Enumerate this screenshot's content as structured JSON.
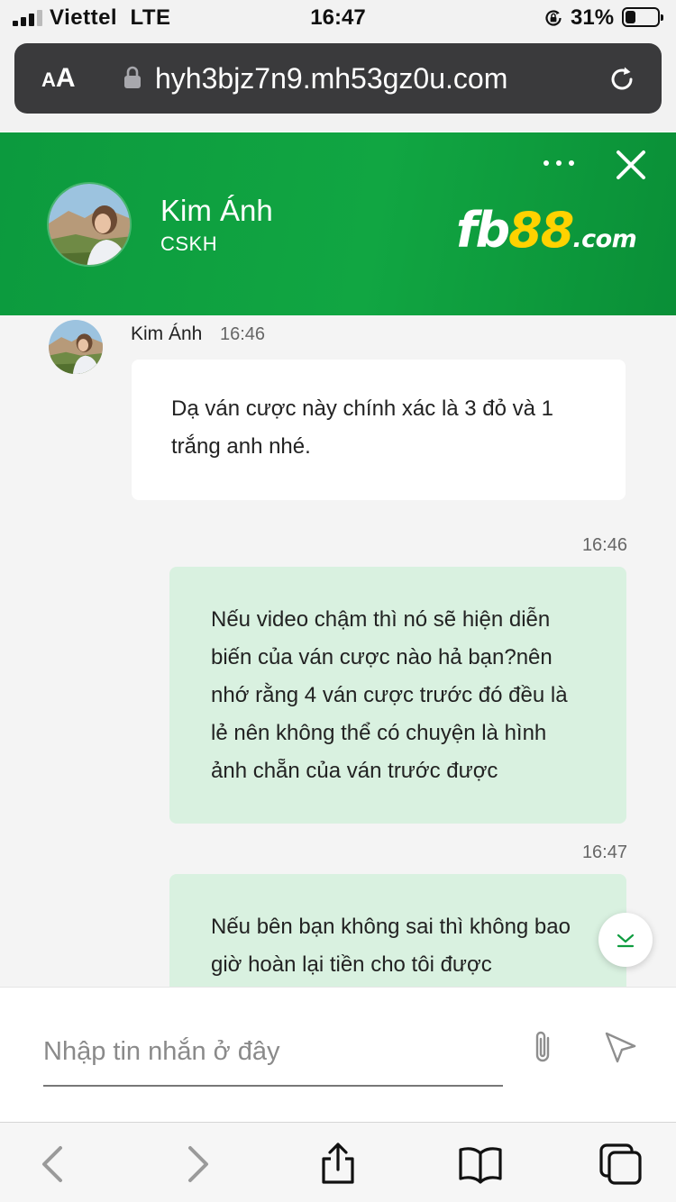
{
  "status_bar": {
    "carrier": "Viettel",
    "network": "LTE",
    "time": "16:47",
    "battery_percent": "31%",
    "battery_level": 0.31
  },
  "browser": {
    "text_size_small": "A",
    "text_size_large": "A",
    "url": "hyh3bjz7n9.mh53gz0u.com"
  },
  "chat_header": {
    "agent_name": "Kim Ánh",
    "agent_role": "CSKH",
    "brand_part1": "fb",
    "brand_part2": "88",
    "brand_part3": ".com",
    "colors": {
      "header_green": "#11a642",
      "brand_yellow": "#ffd200"
    }
  },
  "messages": [
    {
      "direction": "incoming",
      "sender": "Kim Ánh",
      "time": "16:46",
      "text": "Dạ ván cược này chính xác là 3 đỏ và 1 trắng anh nhé."
    },
    {
      "direction": "outgoing",
      "time": "16:46",
      "text": "Nếu video chậm thì nó sẽ hiện diễn biến của ván cược nào hả bạn?nên nhớ rằng 4 ván cược trước đó đều là lẻ nên không thể có chuyện là hình ảnh chẵn của ván trước được"
    },
    {
      "direction": "outgoing",
      "time": "16:47",
      "text": "Nếu bên bạn không sai thì không bao giờ hoàn lại tiền cho tôi được"
    }
  ],
  "composer": {
    "placeholder": "Nhập tin nhắn ở đây",
    "value": ""
  },
  "icons": {
    "header_menu": "more-dots-icon",
    "header_close": "close-icon",
    "scroll": "chevron-down-icon",
    "attach": "paperclip-icon",
    "send": "send-icon",
    "toolbar": [
      "back-icon",
      "forward-icon",
      "share-icon",
      "bookmarks-icon",
      "tabs-icon"
    ]
  }
}
